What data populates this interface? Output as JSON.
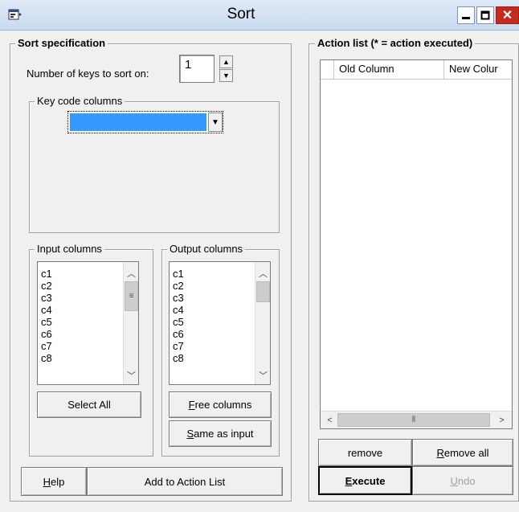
{
  "window": {
    "title": "Sort"
  },
  "icons": {
    "app": "app-icon",
    "minimize": "minimize-icon",
    "maximize": "maximize-icon",
    "close": "close-icon"
  },
  "sort_spec": {
    "title": "Sort  specification",
    "num_keys_label": "Number of keys to sort on:",
    "num_keys_value": "1",
    "key_code_title": "Key code columns",
    "key_code_selected": ""
  },
  "input_columns": {
    "title": "Input columns",
    "items": [
      "c1",
      "c2",
      "c3",
      "c4",
      "c5",
      "c6",
      "c7",
      "c8"
    ],
    "select_all": "Select All"
  },
  "output_columns": {
    "title": "Output columns",
    "items": [
      "c1",
      "c2",
      "c3",
      "c4",
      "c5",
      "c6",
      "c7",
      "c8"
    ],
    "free_columns": "Free columns",
    "same_as_input": "Same as input"
  },
  "buttons": {
    "help": "Help",
    "add_to_action_list": "Add to Action List",
    "remove": "remove",
    "remove_all": "Remove all",
    "execute": "Execute",
    "undo": "Undo"
  },
  "action_list": {
    "title": "Action list (* = action executed)",
    "columns": [
      "Old Column",
      "New Colur"
    ]
  },
  "colors": {
    "selection": "#3399ff",
    "close_button": "#c42b1c"
  }
}
